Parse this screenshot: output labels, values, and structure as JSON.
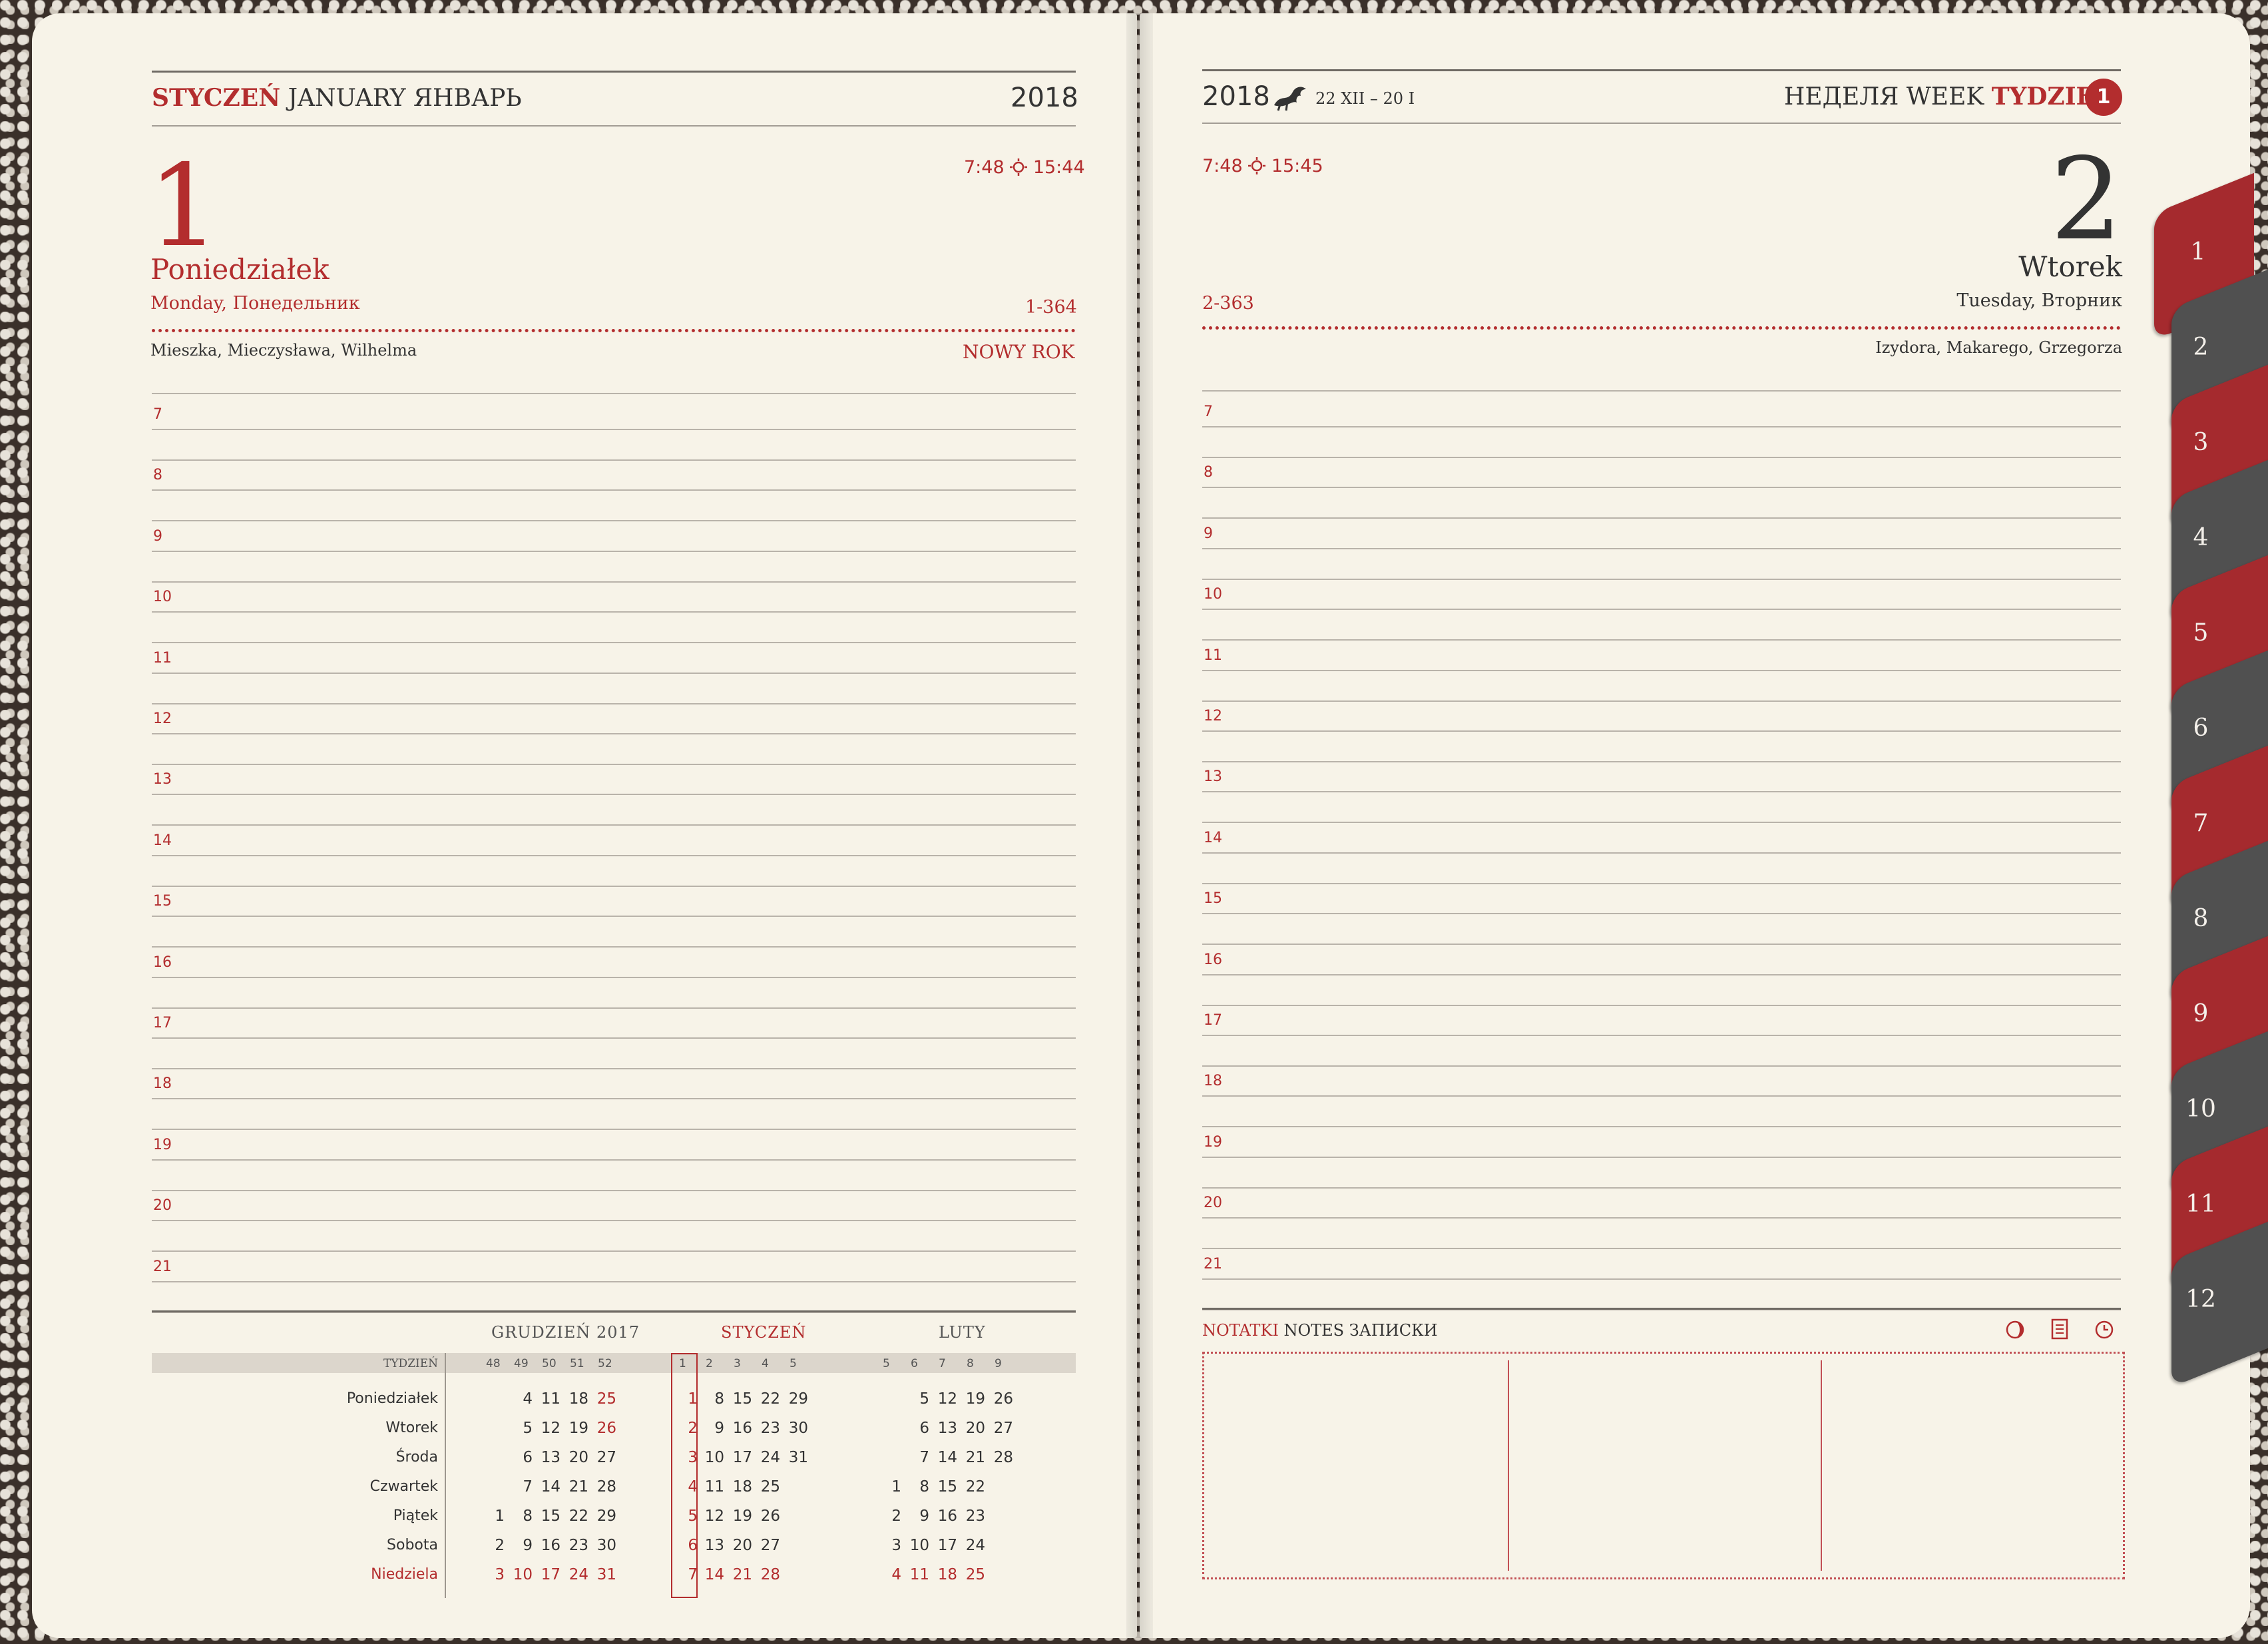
{
  "left_page": {
    "month_pl": "STYCZEŃ",
    "month_en": "JANUARY",
    "month_ru": "ЯНВАРЬ",
    "year": "2018",
    "day_number": "1",
    "weekday_pl": "Poniedziałek",
    "weekday_en_ru": "Monday, Понедельник",
    "sunrise": "7:48",
    "sunset": "15:44",
    "day_of_year": "1-364",
    "name_days": "Mieszka, Mieczysława, Wilhelma",
    "holiday": "NOWY ROK",
    "hours": [
      "7",
      "8",
      "9",
      "10",
      "11",
      "12",
      "13",
      "14",
      "15",
      "16",
      "17",
      "18",
      "19",
      "20",
      "21"
    ]
  },
  "right_page": {
    "year": "2018",
    "week_range": "22 XII – 20 I",
    "week_label_ru": "НЕДЕЛЯ",
    "week_label_en": "WEEK",
    "week_label_pl": "TYDZIEŃ",
    "week_number": "1",
    "day_number": "2",
    "weekday_pl": "Wtorek",
    "weekday_en_ru": "Tuesday, Вторник",
    "sunrise": "7:48",
    "sunset": "15:45",
    "day_of_year": "2-363",
    "name_days": "Izydora, Makarego, Grzegorza",
    "hours": [
      "7",
      "8",
      "9",
      "10",
      "11",
      "12",
      "13",
      "14",
      "15",
      "16",
      "17",
      "18",
      "19",
      "20",
      "21"
    ],
    "notes_label_pl": "NOTATKI",
    "notes_label_en": "NOTES",
    "notes_label_ru": "ЗАПИСКИ"
  },
  "mini_calendar": {
    "week_label": "TYDZIEŃ",
    "months": [
      {
        "name": "GRUDZIEŃ 2017",
        "weeks": [
          "48",
          "49",
          "50",
          "51",
          "52"
        ],
        "rows": [
          [
            "",
            "4",
            "11",
            "18",
            "25"
          ],
          [
            "",
            "5",
            "12",
            "19",
            "26"
          ],
          [
            "",
            "6",
            "13",
            "20",
            "27"
          ],
          [
            "",
            "7",
            "14",
            "21",
            "28"
          ],
          [
            "1",
            "8",
            "15",
            "22",
            "29"
          ],
          [
            "2",
            "9",
            "16",
            "23",
            "30"
          ],
          [
            "3",
            "10",
            "17",
            "24",
            "31"
          ]
        ]
      },
      {
        "name": "STYCZEŃ",
        "weeks": [
          "1",
          "2",
          "3",
          "4",
          "5"
        ],
        "rows": [
          [
            "1",
            "8",
            "15",
            "22",
            "29"
          ],
          [
            "2",
            "9",
            "16",
            "23",
            "30"
          ],
          [
            "3",
            "10",
            "17",
            "24",
            "31"
          ],
          [
            "4",
            "11",
            "18",
            "25",
            ""
          ],
          [
            "5",
            "12",
            "19",
            "26",
            ""
          ],
          [
            "6",
            "13",
            "20",
            "27",
            ""
          ],
          [
            "7",
            "14",
            "21",
            "28",
            ""
          ]
        ]
      },
      {
        "name": "LUTY",
        "weeks": [
          "5",
          "6",
          "7",
          "8",
          "9"
        ],
        "rows": [
          [
            "",
            "5",
            "12",
            "19",
            "26"
          ],
          [
            "",
            "6",
            "13",
            "20",
            "27"
          ],
          [
            "",
            "7",
            "14",
            "21",
            "28"
          ],
          [
            "1",
            "8",
            "15",
            "22",
            ""
          ],
          [
            "2",
            "9",
            "16",
            "23",
            ""
          ],
          [
            "3",
            "10",
            "17",
            "24",
            ""
          ],
          [
            "4",
            "11",
            "18",
            "25",
            ""
          ]
        ]
      }
    ],
    "weekdays": [
      "Poniedziałek",
      "Wtorek",
      "Środa",
      "Czwartek",
      "Piątek",
      "Sobota",
      "Niedziela"
    ]
  },
  "month_tabs": [
    "1",
    "2",
    "3",
    "4",
    "5",
    "6",
    "7",
    "8",
    "9",
    "10",
    "11",
    "12"
  ],
  "icons": [
    "sun-icon",
    "dragon-logo-icon",
    "moon-icon",
    "notebook-icon",
    "clock-icon"
  ],
  "colors": {
    "accent": "#b32d2e",
    "paper": "#f7f3e8",
    "tab_grey": "#505050",
    "tab_red": "#a52a2e"
  }
}
